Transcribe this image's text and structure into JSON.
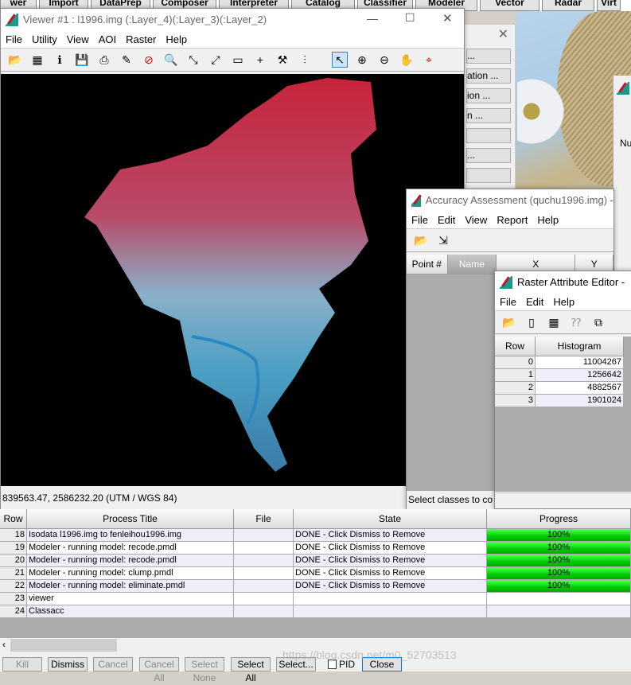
{
  "top_toolbar": [
    "wer",
    "Import",
    "DataPrep",
    "Composer",
    "Interpreter",
    "Catalog",
    "Classifier",
    "Modeler",
    "Vector",
    "Radar",
    "Virt"
  ],
  "background_dialog": {
    "buttons": [
      "...",
      "ation ...",
      "ion ...",
      "n ...",
      "",
      "...",
      ""
    ]
  },
  "background_window2": {
    "label": "Nu"
  },
  "viewer": {
    "title": "Viewer #1 : l1996.img (:Layer_4)(:Layer_3)(:Layer_2)",
    "menu": [
      "File",
      "Utility",
      "View",
      "AOI",
      "Raster",
      "Help"
    ],
    "tools": [
      "open-icon",
      "open-layer-icon",
      "info-icon",
      "save-icon",
      "print-icon",
      "eraser-icon",
      "clear-icon",
      "inquire-icon",
      "zoom-in-2x-icon",
      "zoom-out-2x-icon",
      "measure-icon",
      "crosshair-icon",
      "hammer-icon",
      "profile-icon",
      "select-arrow-icon",
      "zoom-in-icon",
      "zoom-out-icon",
      "pan-hand-icon",
      "inquire-cursor-icon"
    ],
    "status": "839563.47, 2586232.20   (UTM / WGS 84)",
    "colors": {
      "vegetation": "#c8243c",
      "water": "#3aa0c8",
      "background": "#000000"
    }
  },
  "accuracy": {
    "title": "Accuracy Assessment (quchu1996.img) -",
    "menu": [
      "File",
      "Edit",
      "View",
      "Report",
      "Help"
    ],
    "columns": [
      "Point #",
      "Name",
      "X",
      "Y"
    ],
    "status": "Select classes to co"
  },
  "rae": {
    "title": "Raster Attribute Editor -",
    "menu": [
      "File",
      "Edit",
      "Help"
    ],
    "columns": [
      "Row",
      "Histogram"
    ],
    "rows": [
      {
        "row": "0",
        "hist": "11004267"
      },
      {
        "row": "1",
        "hist": "1256642"
      },
      {
        "row": "2",
        "hist": "4882567"
      },
      {
        "row": "3",
        "hist": "1901024"
      }
    ]
  },
  "process_list": {
    "columns": [
      "Row",
      "Process Title",
      "File",
      "State",
      "Progress"
    ],
    "rows": [
      {
        "row": "18",
        "title": "Isodata l1996.img to fenleihou1996.img",
        "file": "",
        "state": "DONE - Click Dismiss to Remove",
        "progress": "100%"
      },
      {
        "row": "19",
        "title": "Modeler - running model: recode.pmdl",
        "file": "",
        "state": "DONE - Click Dismiss to Remove",
        "progress": "100%"
      },
      {
        "row": "20",
        "title": "Modeler - running model: recode.pmdl",
        "file": "",
        "state": "DONE - Click Dismiss to Remove",
        "progress": "100%"
      },
      {
        "row": "21",
        "title": "Modeler - running model: clump.pmdl",
        "file": "",
        "state": "DONE - Click Dismiss to Remove",
        "progress": "100%"
      },
      {
        "row": "22",
        "title": "Modeler - running model: eliminate.pmdl",
        "file": "",
        "state": "DONE - Click Dismiss to Remove",
        "progress": "100%"
      },
      {
        "row": "23",
        "title": "viewer",
        "file": "",
        "state": "",
        "progress": ""
      },
      {
        "row": "24",
        "title": "Classacc",
        "file": "",
        "state": "",
        "progress": ""
      }
    ],
    "buttons": {
      "kill": "Kill",
      "dismiss": "Dismiss",
      "cancel": "Cancel",
      "cancel_all": "Cancel All",
      "select_none": "Select None",
      "select_all": "Select All",
      "select": "Select...",
      "pid": "PID",
      "close": "Close"
    },
    "watermark": "https://blog.csdn.net/m0_52703513"
  }
}
